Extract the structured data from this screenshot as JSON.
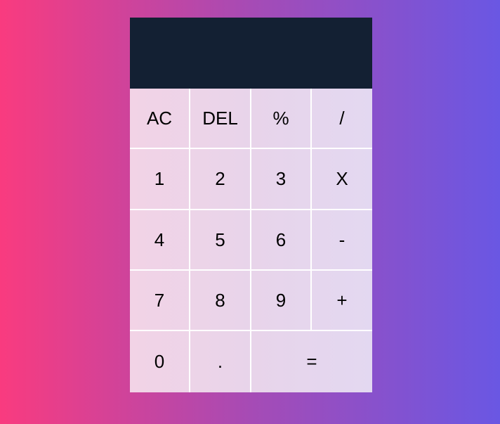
{
  "display": {
    "value": ""
  },
  "keys": {
    "clear": "AC",
    "delete": "DEL",
    "percent": "%",
    "divide": "/",
    "one": "1",
    "two": "2",
    "three": "3",
    "multiply": "X",
    "four": "4",
    "five": "5",
    "six": "6",
    "subtract": "-",
    "seven": "7",
    "eight": "8",
    "nine": "9",
    "add": "+",
    "zero": "0",
    "decimal": ".",
    "equals": "="
  },
  "colors": {
    "background_start": "#f93b7f",
    "background_end": "#6a57e3",
    "display_bg": "#132033",
    "key_bg": "#ebd4ea",
    "key_border": "#ffffff",
    "key_text": "#000000"
  }
}
